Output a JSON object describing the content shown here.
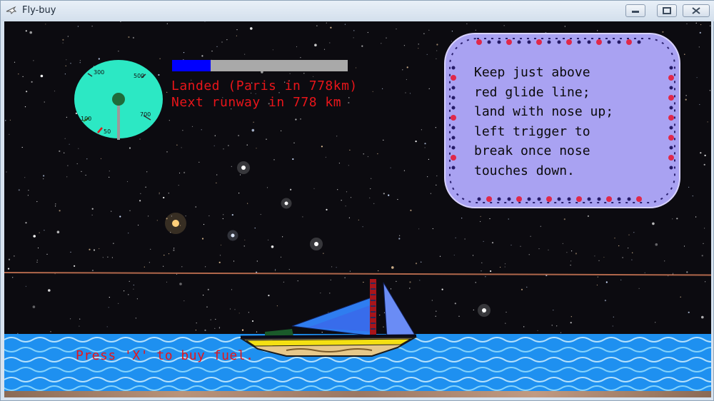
{
  "window": {
    "title": "Fly-buy",
    "app_icon": "airplane-icon",
    "buttons": {
      "minimize": "minimize-icon",
      "maximize": "maximize-icon",
      "close": "close-icon"
    }
  },
  "hud": {
    "gauge": {
      "tick_labels": [
        "300",
        "500",
        "700",
        "100",
        "50"
      ],
      "face_color": "#2ce8c4"
    },
    "fuel": {
      "level_fraction": 0.22,
      "fill_color": "#0000ff",
      "empty_color": "#a9a9a9"
    },
    "status_line_1": "Landed (Paris in 778km)",
    "status_line_2": "Next runway in 778 km",
    "status_color": "#e8151a"
  },
  "instructions": {
    "lines": [
      "Keep just above",
      "red glide line;",
      "land with nose up;",
      "left trigger to",
      "break once nose",
      "touches down."
    ],
    "panel_color": "#a9a2f2"
  },
  "prompt": {
    "buy_fuel": "Press 'X' to buy fuel."
  },
  "scene": {
    "sea_color": "#1e90f0",
    "glide_line_color": "#b0674b",
    "sail_color": "#2f7df0"
  }
}
